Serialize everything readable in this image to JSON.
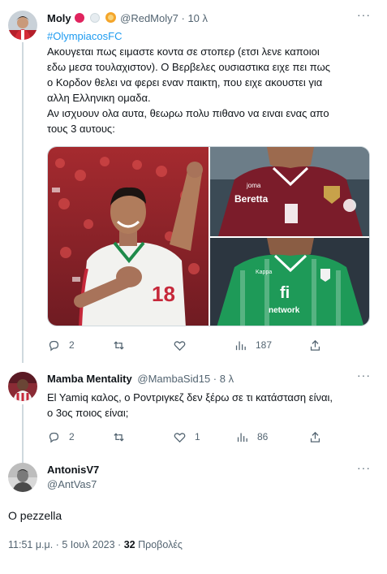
{
  "tweet1": {
    "name": "Moly",
    "handle": "@RedMoly7",
    "time": "10 λ",
    "hashtag": "#OlympiacosFC",
    "body_lines": [
      "Ακουγεται πως ειμαστε κοντα σε στοπερ (ετσι λενε καποιοι",
      "εδω μεσα τουλαχιστον). Ο Βερβελες ουσιαστικα ειχε πει πως",
      "ο Κορδον θελει να φερει εναν παικτη, που ειχε ακουστει για",
      "αλλη Ελληνικη ομαδα.",
      "Αν ισχυουν ολα αυτα, θεωρω πολυ πιθανο να ειναι ενας απο",
      "τους 3 αυτους:"
    ],
    "media_text": {
      "shirt_left_number": "18",
      "shirt_top_sponsor": "Beretta",
      "shirt_top_brand": "joma",
      "shirt_bottom_sponsor": "network",
      "shirt_bottom_brand": "Kappa",
      "shirt_bottom_logo": "fi"
    },
    "replies": "2",
    "retweets": "",
    "likes": "",
    "views": "187"
  },
  "tweet2": {
    "name": "Mamba Mentality",
    "handle": "@MambaSid15",
    "time": "8 λ",
    "body_lines": [
      "El Yamiq καλος, ο Ροντριγκεζ δεν ξέρω σε τι κατάσταση είναι,",
      "ο 3ος ποιος είναι;"
    ],
    "replies": "2",
    "retweets": "",
    "likes": "1",
    "views": "86"
  },
  "tweet3": {
    "name": "AntonisV7",
    "handle": "@AntVas7",
    "body": "Ο pezzella",
    "time": "11:51 μ.μ.",
    "separator": "·",
    "date": "5 Ιουλ 2023",
    "views_count": "32",
    "views_label": "Προβολές"
  },
  "colors": {
    "accent": "#1d9bf0",
    "text": "#0f1419",
    "muted": "#536471",
    "line": "#cfd9de",
    "red_dot": "#e0245e"
  },
  "icons": [
    "more-icon",
    "reply-icon",
    "retweet-icon",
    "like-icon",
    "views-icon",
    "share-icon"
  ]
}
